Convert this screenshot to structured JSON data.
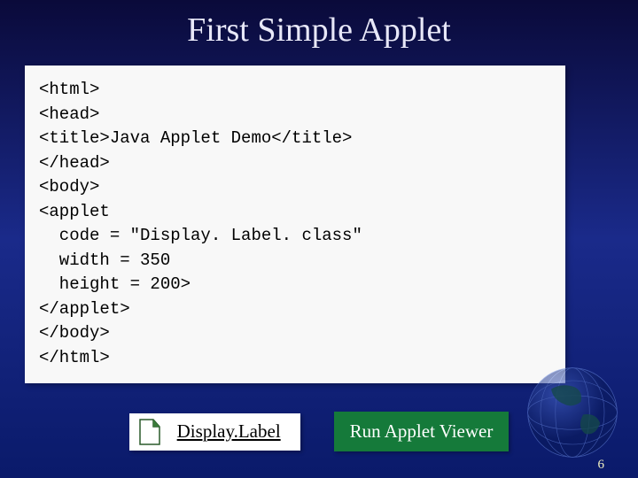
{
  "slide": {
    "title": "First Simple Applet",
    "page_number": "6"
  },
  "code": {
    "lines": [
      "<html>",
      "<head>",
      "<title>Java Applet Demo</title>",
      "</head>",
      "<body>",
      "<applet",
      "  code = \"Display. Label. class\"",
      "  width = 350",
      "  height = 200>",
      "</applet>",
      "</body>",
      "</html>"
    ]
  },
  "file_link": {
    "label": "Display.Label",
    "icon": "file-icon"
  },
  "button": {
    "run_label": "Run Applet Viewer"
  }
}
